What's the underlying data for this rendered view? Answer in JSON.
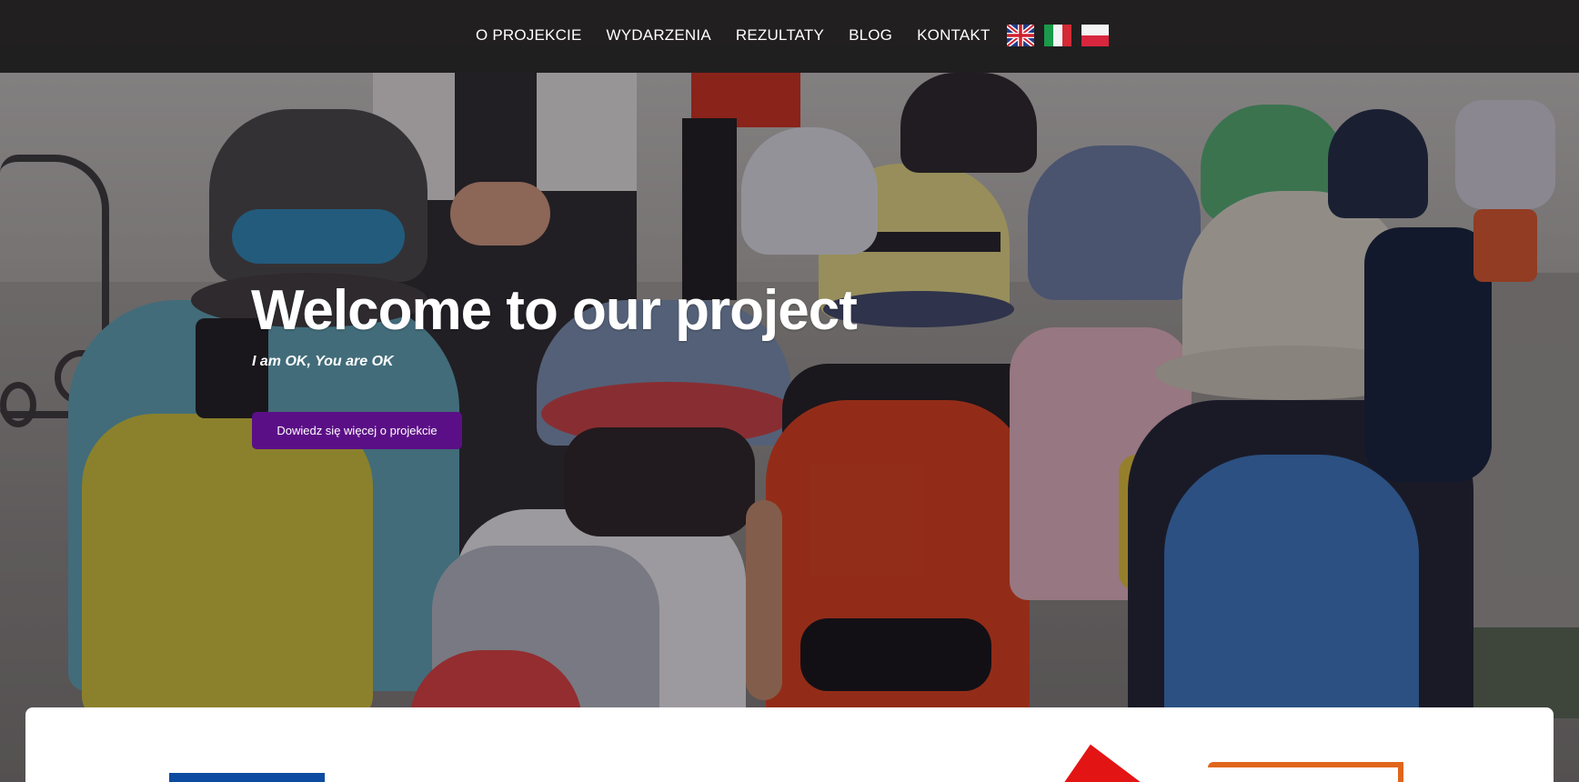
{
  "nav": {
    "items": [
      {
        "label": "O PROJEKCIE"
      },
      {
        "label": "WYDARZENIA"
      },
      {
        "label": "REZULTATY"
      },
      {
        "label": "BLOG"
      },
      {
        "label": "KONTAKT"
      }
    ],
    "flags": [
      {
        "icon": "uk-flag-icon"
      },
      {
        "icon": "italy-flag-icon"
      },
      {
        "icon": "poland-flag-icon"
      }
    ]
  },
  "hero": {
    "title": "Welcome to our project",
    "subtitle": "I am OK, You are OK",
    "cta_label": "Dowiedz się więcej o projekcie"
  },
  "colors": {
    "accent": "#5b0f86",
    "navbar": "#141315",
    "text": "#ffffff"
  }
}
